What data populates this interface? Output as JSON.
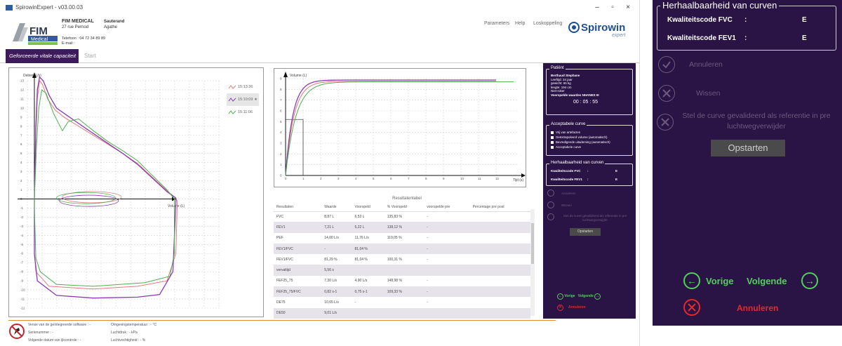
{
  "window": {
    "title": "SpirowinExpert - v03.00.03",
    "min": "–",
    "max": "▫",
    "close": "×"
  },
  "header": {
    "logo_text": "FIM",
    "logo_sub": "Medical",
    "org_name": "FIM MEDICAL",
    "org_address": "27 rue Pernod",
    "patient_short_name": "Sauterand",
    "patient_short_sub": "Agathe",
    "phone": "Telefoon : 04 72 34 89 89",
    "email": "E-mail :",
    "menu": [
      "Parameters",
      "Help",
      "Loskoppeling"
    ],
    "brand": "Spirowin",
    "brand_sub": "expert"
  },
  "tabs": {
    "active": "Geforceerde vitale capaciteit",
    "start": "Start"
  },
  "flow_chart": {
    "y_label": "Debiet (L/s)",
    "x_label": "Volume (L)",
    "y_ticks": [
      "13",
      "12",
      "11",
      "10",
      "9",
      "8",
      "7",
      "6",
      "5",
      "4",
      "3",
      "2",
      "1",
      "0",
      "-1",
      "-2",
      "-3",
      "-4",
      "-5",
      "-6",
      "-7",
      "-8",
      "-9",
      "-10",
      "-11",
      "-12"
    ],
    "legend": [
      {
        "time": "15:13:36",
        "color": "#e07b7b"
      },
      {
        "time": "15:10:09",
        "color": "#8b3bb3"
      },
      {
        "time": "15:11:06",
        "color": "#4caf50"
      }
    ],
    "star": "★"
  },
  "volume_chart": {
    "y_label": "Volume (L)",
    "x_label": "Tijd (s)",
    "y_ticks": [
      "9",
      "8",
      "7",
      "6",
      "5",
      "4",
      "3",
      "2",
      "1",
      "0"
    ],
    "x_ticks": [
      "0",
      "1",
      "2",
      "3",
      "4",
      "5",
      "6",
      "7",
      "8",
      "9",
      "10",
      "11",
      "12"
    ]
  },
  "results": {
    "title": "Resultatentabel",
    "columns": [
      "Resultaten",
      "Waarde",
      "Voorspeld",
      "% Voorspeld",
      "voorspelde pre",
      "Percentage pre post"
    ],
    "rows": [
      [
        "FVC",
        "8,87 L",
        "6,53 L",
        "135,83 %",
        "-"
      ],
      [
        "FEV1",
        "7,21 L",
        "5,22 L",
        "138,12 %",
        "-"
      ],
      [
        "PEF",
        "14,00 L/s",
        "11,76 L/s",
        "119,05 %",
        "-"
      ],
      [
        "FEV1/FVC",
        "-",
        "81,04 %",
        "",
        "-"
      ],
      [
        "FEV1/FVC",
        "81,29 %",
        "81,04 %",
        "100,31 %",
        "-"
      ],
      [
        "vervaltijd",
        "5,56 s",
        "",
        "",
        ""
      ],
      [
        "FEF25_75",
        "7,30 L/s",
        "4,90 L/s",
        "148,98 %",
        "-"
      ],
      [
        "FEF25_75/FVC",
        "0,82 s-1",
        "0,75 s-1",
        "109,33 %",
        "-"
      ],
      [
        "DE75",
        "10,65 L/s",
        "-",
        "",
        "-"
      ],
      [
        "DE50",
        "9,01 L/s",
        "",
        "",
        ""
      ]
    ]
  },
  "side": {
    "patient_legend": "Patiënt",
    "patient_name": "Berthaud Stephane",
    "age": "Leeftijd: 34 jaar",
    "weight": "gewicht: 65 kg",
    "height": "lengte: 194 cm",
    "smoker": "Niet-roker",
    "predicted": "Voorspelde waardes NHANES III",
    "timer": "00 : 05 : 55",
    "acc_legend": "Acceptabele curve",
    "checks": [
      "Vrij van artefacten",
      "Geëxtrapoleerd volume (automatisch)",
      "Bevredigende uitademing (automatisch)",
      "Acceptabele curve"
    ],
    "rep_legend": "Herhaalbaarheid van curven",
    "fvc_label": "Kwaliteitscode FVC",
    "fev1_label": "Kwaliteitscode FEV1",
    "colon": ":",
    "fvc_code": "E",
    "fev1_code": "E",
    "cancel_dim": "Annuleren",
    "wipe": "Wissen",
    "ref_text": "Stel de curve gevalideerd als referentie in pre luchtwegverwijder",
    "start_btn": "Opstarten",
    "prev": "Vorige",
    "next": "Volgende",
    "cancel": "Annuleren"
  },
  "footer": {
    "sw_version": "Versie van de geïntegreerde software : -",
    "serial": "Serienummer : -",
    "next_check": "Volgende datum van ijkcontrole : -",
    "ambient_temp": "Omgevingstemperatuur : - °C",
    "pressure": "Luchtdruk : - kPa",
    "humidity": "Luchtvochtigheid : - %"
  },
  "colors": {
    "purple_dark": "#2a1345",
    "tab_active": "#3c1a5b",
    "green": "#52d15a",
    "red": "#e52a2a",
    "series_red": "#e07b7b",
    "series_purple": "#8b3bb3",
    "series_green": "#4caf50"
  }
}
